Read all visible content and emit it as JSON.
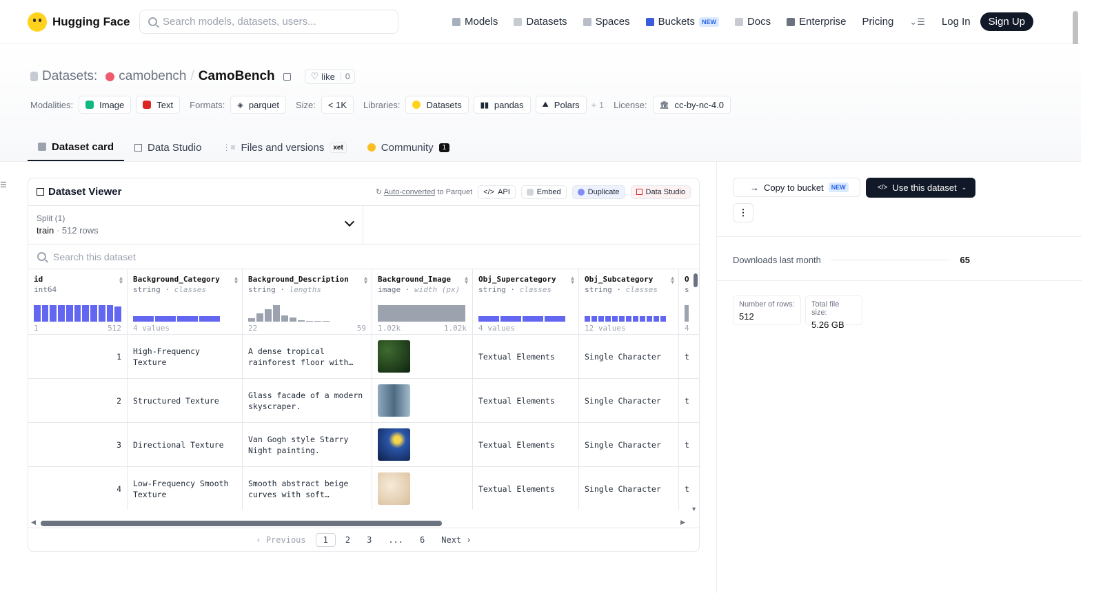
{
  "nav": {
    "brand": "Hugging Face",
    "search_placeholder": "Search models, datasets, users...",
    "links": [
      {
        "label": "Models",
        "icon": "models-icon"
      },
      {
        "label": "Datasets",
        "icon": "datasets-icon"
      },
      {
        "label": "Spaces",
        "icon": "spaces-icon"
      },
      {
        "label": "Buckets",
        "icon": "buckets-icon",
        "badge": "NEW"
      },
      {
        "label": "Docs",
        "icon": "docs-icon"
      },
      {
        "label": "Enterprise",
        "icon": "enterprise-icon"
      },
      {
        "label": "Pricing"
      }
    ],
    "login": "Log In",
    "signup": "Sign Up"
  },
  "repo": {
    "kind": "Datasets:",
    "org": "camobench",
    "sep": "/",
    "name": "CamoBench",
    "like_label": "like",
    "like_count": "0"
  },
  "meta": {
    "modalities_label": "Modalities:",
    "modalities": [
      "Image",
      "Text"
    ],
    "formats_label": "Formats:",
    "format": "parquet",
    "size_label": "Size:",
    "size": "< 1K",
    "libraries_label": "Libraries:",
    "libraries": [
      "Datasets",
      "pandas",
      "Polars"
    ],
    "libraries_more": "+ 1",
    "license_label": "License:",
    "license": "cc-by-nc-4.0"
  },
  "tabs": [
    {
      "label": "Dataset card"
    },
    {
      "label": "Data Studio"
    },
    {
      "label": "Files and versions",
      "badge": "xet"
    },
    {
      "label": "Community",
      "badge": "1"
    }
  ],
  "viewer": {
    "title": "Dataset Viewer",
    "auto_converted": "Auto-converted",
    "to_parquet": " to Parquet",
    "buttons": [
      "API",
      "Embed",
      "Duplicate",
      "Data Studio"
    ],
    "split_label": "Split (1)",
    "split_name": "train",
    "split_rows": "512 rows",
    "search_placeholder": "Search this dataset",
    "columns": [
      {
        "name": "id",
        "type": "int64",
        "sub": "",
        "foot_l": "1",
        "foot_r": "512"
      },
      {
        "name": "Background_Category",
        "type": "string",
        "sub": "classes",
        "foot_l": "4 values",
        "foot_r": ""
      },
      {
        "name": "Background_Description",
        "type": "string",
        "sub": "lengths",
        "foot_l": "22",
        "foot_r": "59"
      },
      {
        "name": "Background_Image",
        "type": "image",
        "sub": "width (px)",
        "foot_l": "1.02k",
        "foot_r": "1.02k"
      },
      {
        "name": "Obj_Supercategory",
        "type": "string",
        "sub": "classes",
        "foot_l": "4 values",
        "foot_r": ""
      },
      {
        "name": "Obj_Subcategory",
        "type": "string",
        "sub": "classes",
        "foot_l": "12 values",
        "foot_r": ""
      },
      {
        "name": "O",
        "type": "s",
        "sub": "",
        "foot_l": "4",
        "foot_r": ""
      }
    ],
    "rows": [
      {
        "id": "1",
        "cat": "High-Frequency Texture",
        "desc": "A dense tropical rainforest floor with…",
        "sup": "Textual Elements",
        "sub": "Single Character",
        "o": "t",
        "thumb": "#1f3b1c"
      },
      {
        "id": "2",
        "cat": "Structured Texture",
        "desc": "Glass facade of a modern skyscraper.",
        "sup": "Textual Elements",
        "sub": "Single Character",
        "o": "t",
        "thumb": "#5e7f98"
      },
      {
        "id": "3",
        "cat": "Directional Texture",
        "desc": "Van Gogh style Starry Night painting.",
        "sup": "Textual Elements",
        "sub": "Single Character",
        "o": "t",
        "thumb": "#1d3a78"
      },
      {
        "id": "4",
        "cat": "Low-Frequency Smooth Texture",
        "desc": "Smooth abstract beige curves with soft…",
        "sup": "Textual Elements",
        "sub": "Single Character",
        "o": "t",
        "thumb": "#e2cdb0"
      }
    ],
    "pager": {
      "prev": "‹ Previous",
      "pages": [
        "1",
        "2",
        "3",
        "...",
        "6"
      ],
      "next": "Next ›",
      "current": "1"
    }
  },
  "sidebar": {
    "copy_bucket": "Copy to bucket",
    "copy_badge": "NEW",
    "use_dataset": "Use this dataset",
    "downloads_label": "Downloads last month",
    "downloads_value": "65",
    "rows_label": "Number of rows:",
    "rows_value": "512",
    "size_label": "Total file size:",
    "size_value": "5.26 GB"
  },
  "colors": {
    "accent": "#6366f1",
    "dark": "#111827",
    "hist_gray": "#9ca3af"
  }
}
